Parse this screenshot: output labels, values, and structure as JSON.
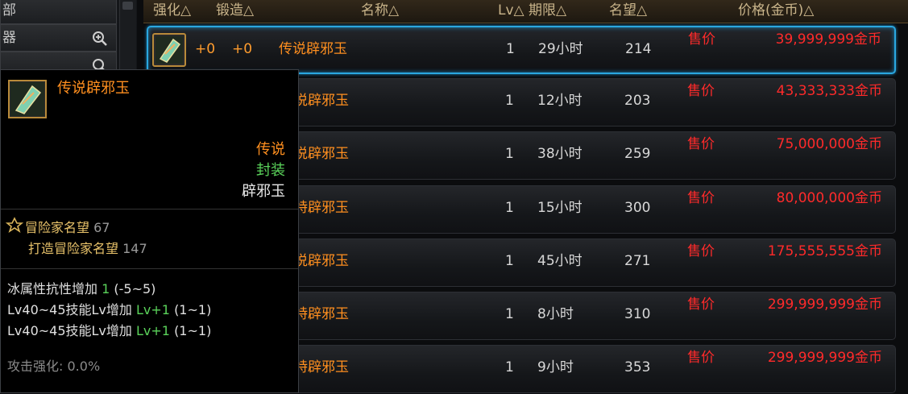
{
  "sidebar": {
    "items": [
      {
        "label": "部"
      },
      {
        "label": "器"
      },
      {
        "label": ""
      }
    ]
  },
  "header": {
    "enhance": "强化△",
    "forge": "锻造△",
    "name": "名称△",
    "level": "Lv△",
    "duration": "期限△",
    "fame": "名望△",
    "price": "价格(金币)△"
  },
  "listings": [
    {
      "enhance": "+0",
      "forge": "+0",
      "name": "传说辟邪玉",
      "level": "1",
      "duration": "29小时",
      "fame": "214",
      "sale_label": "售价",
      "price": "39,999,999金币"
    },
    {
      "name": "说辟邪玉",
      "level": "1",
      "duration": "12小时",
      "fame": "203",
      "sale_label": "售价",
      "price": "43,333,333金币"
    },
    {
      "name": "说辟邪玉",
      "level": "1",
      "duration": "38小时",
      "fame": "259",
      "sale_label": "售价",
      "price": "75,000,000金币"
    },
    {
      "name": "特辟邪玉",
      "level": "1",
      "duration": "15小时",
      "fame": "300",
      "sale_label": "售价",
      "price": "80,000,000金币"
    },
    {
      "name": "说辟邪玉",
      "level": "1",
      "duration": "45小时",
      "fame": "271",
      "sale_label": "售价",
      "price": "175,555,555金币"
    },
    {
      "name": "特辟邪玉",
      "level": "1",
      "duration": "8小时",
      "fame": "310",
      "sale_label": "售价",
      "price": "299,999,999金币"
    },
    {
      "name": "特辟邪玉",
      "level": "1",
      "duration": "9小时",
      "fame": "353",
      "sale_label": "售价",
      "price": "299,999,999金币"
    }
  ],
  "tooltip": {
    "title": "传说辟邪玉",
    "rarity": "传说",
    "bind": "封装",
    "type": "辟邪玉",
    "fame_label": "冒险家名望",
    "fame_value": "67",
    "forge_fame_label": "打造冒险家名望",
    "forge_fame_value": "147",
    "stat1_label": "冰属性抗性增加",
    "stat1_value": "1",
    "stat1_range": "(-5~5)",
    "stat2_label": "Lv40~45技能Lv增加",
    "stat2_value": "Lv+1",
    "stat2_range": "(1~1)",
    "stat3_label": "Lv40~45技能Lv增加",
    "stat3_value": "Lv+1",
    "stat3_range": "(1~1)",
    "attack_label": "攻击强化:",
    "attack_value": "0.0%"
  },
  "colors": {
    "selection_border": "#2aa7e0",
    "item_name": "#ff8f1f",
    "price": "#ff2a2a",
    "bind_green": "#5ad25a"
  }
}
